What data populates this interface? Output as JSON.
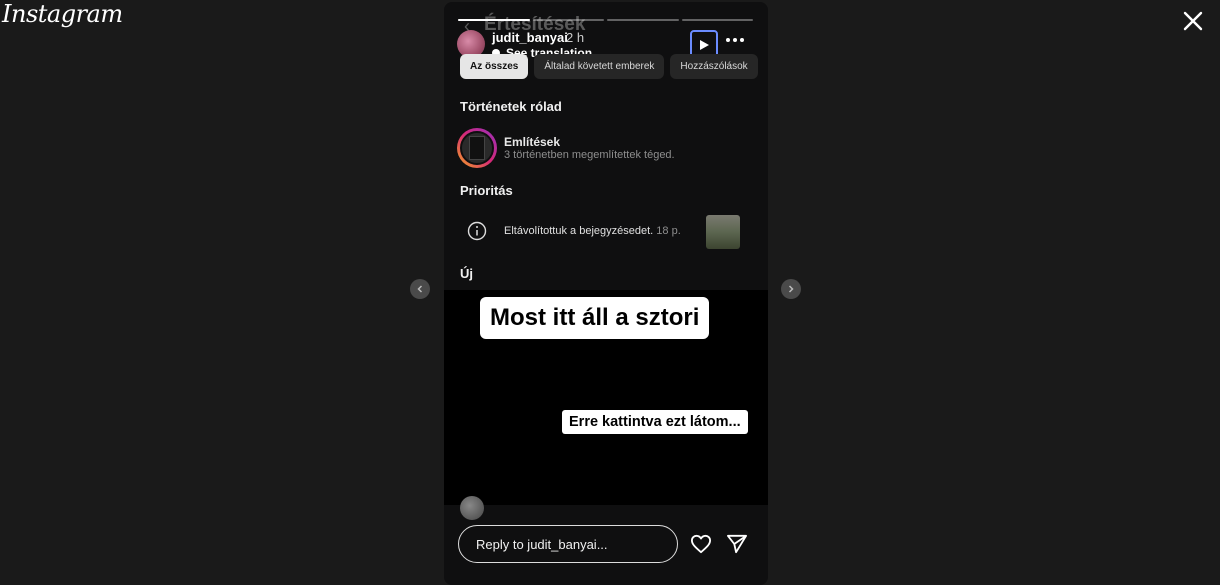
{
  "app": {
    "logo": "Instagram"
  },
  "story": {
    "progress": [
      1.0,
      0.0,
      0.0,
      0.0
    ],
    "background_title": "Értesítések",
    "username": "judit_banyai",
    "time": "2 h",
    "see_translation": "See translation",
    "chips": [
      "Az összes",
      "Általad követett emberek",
      "Hozzászólások"
    ],
    "sections": {
      "about_you": "Történetek rólad",
      "priority": "Prioritás",
      "new": "Új"
    },
    "mentions": {
      "title": "Említések",
      "subtitle": "3 történetben megemlítettek téged."
    },
    "priority_item": {
      "text": "Eltávolítottuk a bejegyzésedet.",
      "time": "18 p."
    },
    "sticker_main": "Most itt áll a sztori",
    "sticker_secondary": "Erre kattintva ezt látom...",
    "reply_placeholder": "Reply to judit_banyai..."
  }
}
